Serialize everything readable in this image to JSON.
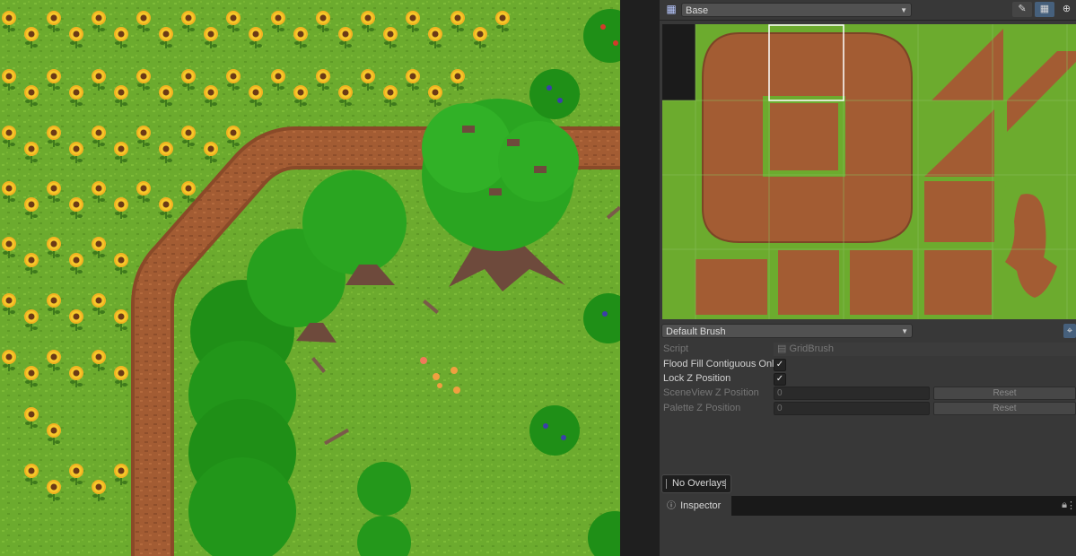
{
  "palette_toolbar": {
    "icon": "tile-palette-icon",
    "palette_name": "Base"
  },
  "brush": {
    "selected": "Default Brush"
  },
  "properties": {
    "script_label": "Script",
    "script_value": "GridBrush",
    "flood_fill_label": "Flood Fill Contiguous Only",
    "flood_fill_checked": true,
    "lock_z_label": "Lock Z Position",
    "lock_z_checked": true,
    "sceneview_z_label": "SceneView Z Position",
    "sceneview_z_value": "0",
    "palette_z_label": "Palette Z Position",
    "palette_z_value": "0",
    "reset_label": "Reset"
  },
  "overlays": {
    "label": "No Overlays"
  },
  "inspector": {
    "tab_label": "Inspector"
  },
  "colors": {
    "grass": "#6cab2e",
    "dirt": "#a35c33",
    "tree": "#26a31c",
    "panel_bg": "#383838",
    "accent": "#46607c"
  }
}
